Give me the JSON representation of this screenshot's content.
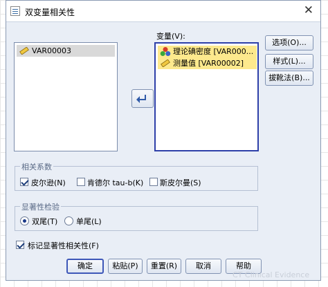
{
  "title": "双变量相关性",
  "close_symbol": "✕",
  "source_list": {
    "items": [
      "VAR00003"
    ]
  },
  "variables_label": "变量(V):",
  "target_list": {
    "items": [
      "理论碘密度 [VAR000...",
      "测量值 [VAR00002]"
    ]
  },
  "side_buttons": {
    "options": "选项(O)...",
    "style": "样式(L)...",
    "bootstrap": "拔靴法(B)..."
  },
  "correlation_group": {
    "title": "相关系数",
    "pearson": {
      "label": "皮尔逊(N)",
      "checked": true
    },
    "kendall": {
      "label": "肯德尔 tau-b(K)",
      "checked": false
    },
    "spearman": {
      "label": "斯皮尔曼(S)",
      "checked": false
    }
  },
  "significance_group": {
    "title": "显著性检验",
    "two_tailed": {
      "label": "双尾(T)",
      "selected": true
    },
    "one_tailed": {
      "label": "单尾(L)",
      "selected": false
    }
  },
  "flag_significant": {
    "label": "标记显著性相关性(F)",
    "checked": true
  },
  "bottom_buttons": {
    "ok": "确定",
    "paste": "粘贴(P)",
    "reset": "重置(R)",
    "cancel": "取消",
    "help": "帮助"
  },
  "watermark": "CT Clinical Evidence"
}
